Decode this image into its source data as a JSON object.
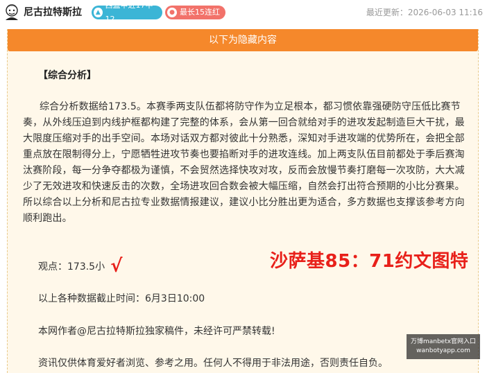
{
  "header": {
    "author": "尼古拉特斯拉",
    "record_badge": "西篮甲近17中12",
    "streak_badge": "最长15连红",
    "update_time": "最近更新：2026-06-03 11:16"
  },
  "hidden_bar": "以下为隐藏内容",
  "content": {
    "section_title": "【综合分析】",
    "analysis": "综合分析数据给173.5。本赛季两支队伍都将防守作为立足根本，都习惯依靠强硬防守压低比赛节奏，从外线压迫到内线护框都构建了完整的体系，会从第一回合就给对手的进攻发起制造巨大干扰，最大限度压缩对手的出手空间。本场对话双方都对彼此十分熟悉，深知对手进攻端的优势所在，会把全部重点放在限制得分上，宁愿牺牲进攻节奏也要掐断对手的进攻连线。加上两支队伍目前都处于季后赛淘汰赛阶段，每一分争夺都极为谨慎，不会贸然选择快攻对攻，反而会放慢节奏打磨每一次攻防，大大减少了无效进攻和快速反击的次数，全场进攻回合数会被大幅压缩，自然会打出符合预期的小比分赛果。所以综合以上分析和尼古拉专业数据情报建议，建议小比分胜出更为适合，多方数据也支撑该参考方向顺利跑出。",
    "view_label": "观点：173.5小",
    "check": "√",
    "prediction_overlay": "沙萨基85：71约文图特",
    "cutoff": "以上各种数据截止时间：6月3日10:00",
    "copyright": "本网作者@尼古拉特斯拉独家稿件，未经许可严禁转载!",
    "disclaimer": "资讯仅供体育爱好者浏览、参考之用。任何人不得用于非法用途，否则责任自负。"
  },
  "watermark": {
    "line1": "万博manbetx官网入口",
    "line2": "wanbotyapp.com"
  },
  "colors": {
    "accent_orange": "#f5882b",
    "record_badge": "#3bb5d6",
    "streak_badge": "#f2726a",
    "highlight_red": "#e8201a",
    "card_bg": "#fff8ea"
  }
}
